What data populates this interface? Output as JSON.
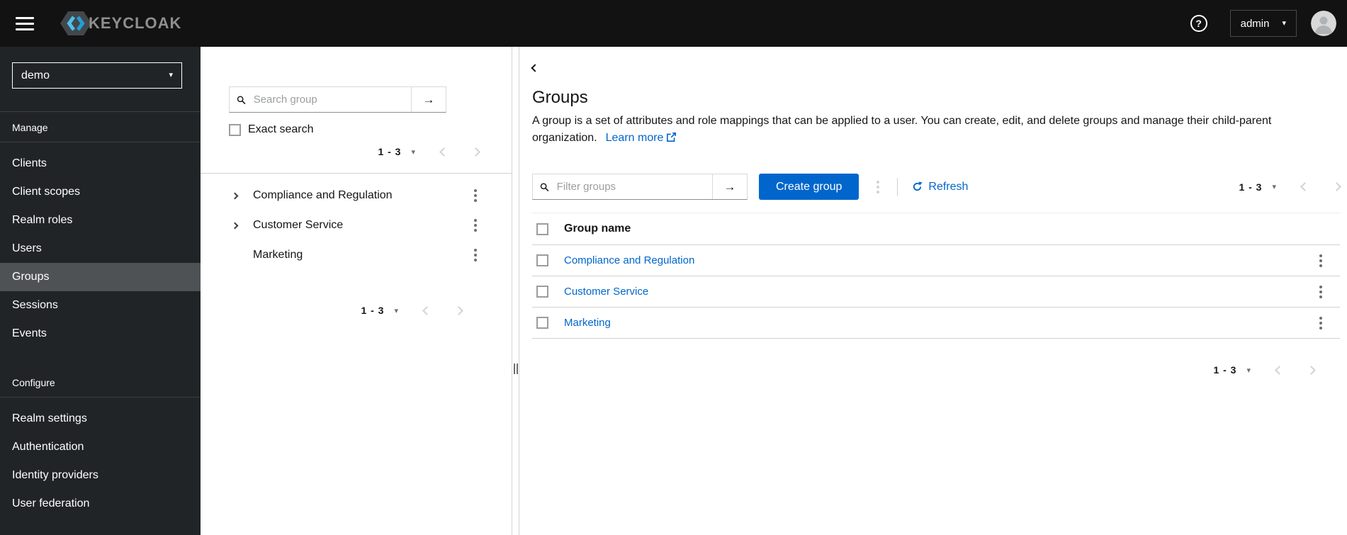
{
  "icons": {
    "caret_down": "▾",
    "arrow_right": "→",
    "help": "?"
  },
  "topbar": {
    "brand": "KEYCLOAK",
    "username": "admin"
  },
  "sidebar": {
    "realm": "demo",
    "manage_label": "Manage",
    "manage_items": [
      "Clients",
      "Client scopes",
      "Realm roles",
      "Users",
      "Groups",
      "Sessions",
      "Events"
    ],
    "selected_item": "Groups",
    "configure_label": "Configure",
    "configure_items": [
      "Realm settings",
      "Authentication",
      "Identity providers",
      "User federation"
    ]
  },
  "tree_panel": {
    "search_placeholder": "Search group",
    "exact_search_label": "Exact search",
    "pagination_top": {
      "range": "1 - 3"
    },
    "items": [
      {
        "name": "Compliance and Regulation",
        "expandable": true
      },
      {
        "name": "Customer Service",
        "expandable": true
      },
      {
        "name": "Marketing",
        "expandable": false
      }
    ],
    "pagination_bottom": {
      "range": "1 - 3"
    }
  },
  "main": {
    "title": "Groups",
    "description": "A group is a set of attributes and role mappings that can be applied to a user. You can create, edit, and delete groups and manage their child-parent organization.",
    "learn_more_label": "Learn more",
    "toolbar": {
      "filter_placeholder": "Filter groups",
      "create_button_label": "Create group",
      "refresh_label": "Refresh",
      "pagination": {
        "range": "1 - 3"
      }
    },
    "table": {
      "group_name_column": "Group name",
      "rows": [
        "Compliance and Regulation",
        "Customer Service",
        "Marketing"
      ]
    },
    "pagination_bottom": {
      "range": "1 - 3"
    }
  },
  "colors": {
    "accent": "#0066cc",
    "link": "#0066cc",
    "topbar_bg": "#121212",
    "sidebar_bg": "#212427",
    "sidebar_selected_bg": "#4f5255",
    "border": "#d2d2d2"
  }
}
